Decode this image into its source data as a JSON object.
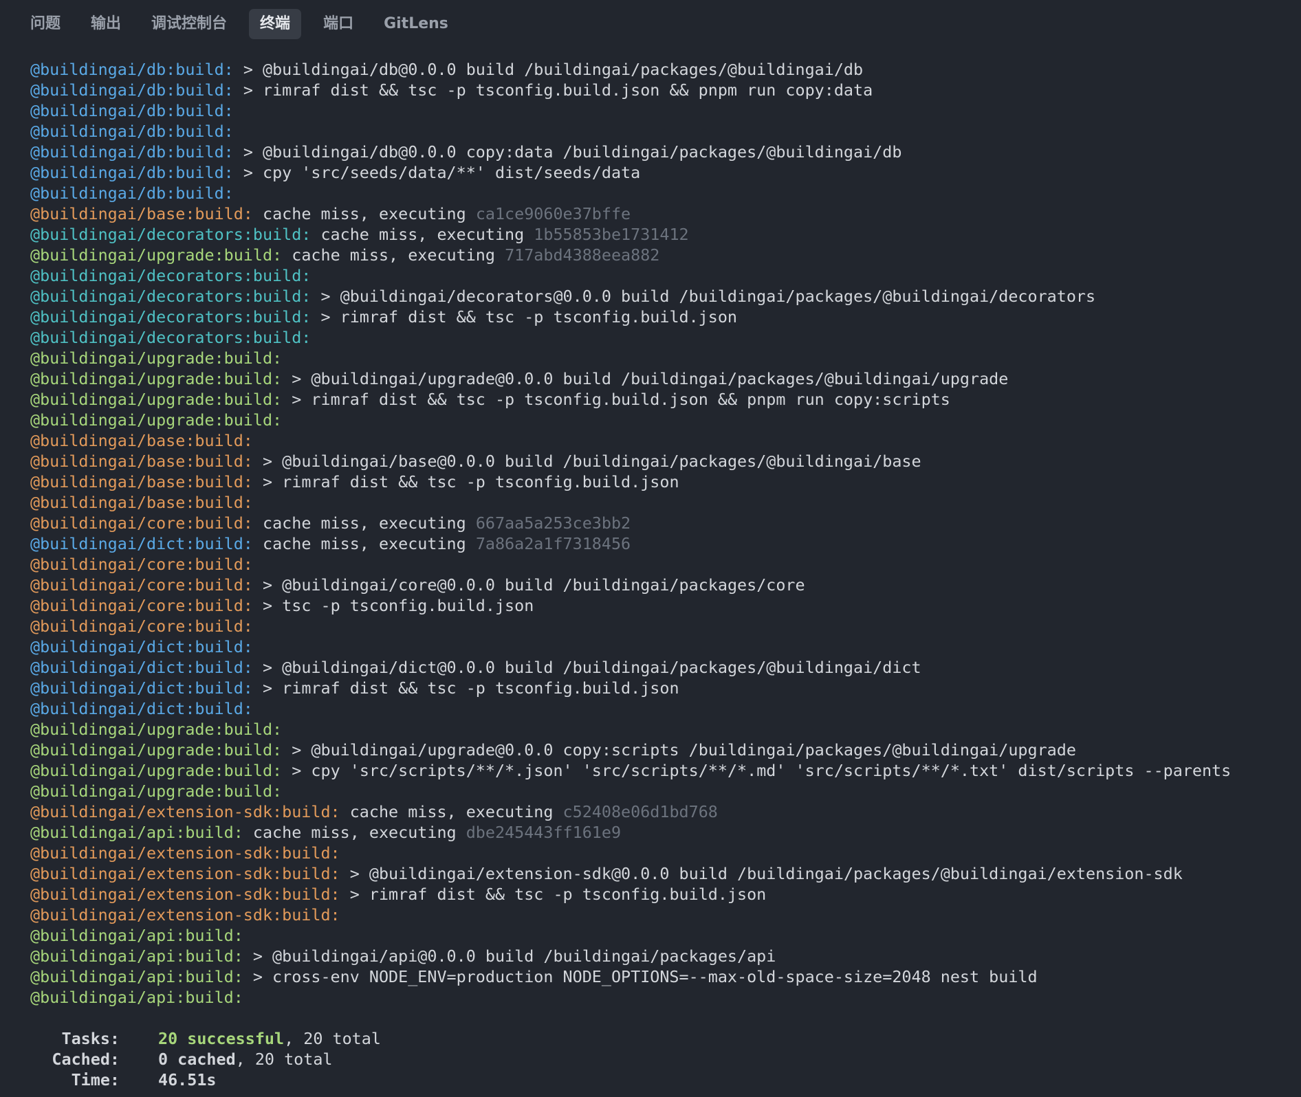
{
  "tabs": [
    {
      "label": "问题",
      "active": false
    },
    {
      "label": "输出",
      "active": false
    },
    {
      "label": "调试控制台",
      "active": false
    },
    {
      "label": "终端",
      "active": true
    },
    {
      "label": "端口",
      "active": false
    },
    {
      "label": "GitLens",
      "active": false
    }
  ],
  "colors": {
    "blue": "#5aa9e6",
    "orange": "#e29a5a",
    "green": "#a7d67b",
    "cyan": "#4fc1c4",
    "hash": "#6c737e",
    "text": "#d3d6db",
    "background": "#22262e"
  },
  "lines": [
    {
      "prefix": "@buildingai/db:build:",
      "color": "blue",
      "text": " > @buildingai/db@0.0.0 build /buildingai/packages/@buildingai/db"
    },
    {
      "prefix": "@buildingai/db:build:",
      "color": "blue",
      "text": " > rimraf dist && tsc -p tsconfig.build.json && pnpm run copy:data"
    },
    {
      "prefix": "@buildingai/db:build:",
      "color": "blue",
      "text": ""
    },
    {
      "prefix": "@buildingai/db:build:",
      "color": "blue",
      "text": ""
    },
    {
      "prefix": "@buildingai/db:build:",
      "color": "blue",
      "text": " > @buildingai/db@0.0.0 copy:data /buildingai/packages/@buildingai/db"
    },
    {
      "prefix": "@buildingai/db:build:",
      "color": "blue",
      "text": " > cpy 'src/seeds/data/**' dist/seeds/data"
    },
    {
      "prefix": "@buildingai/db:build:",
      "color": "blue",
      "text": ""
    },
    {
      "prefix": "@buildingai/base:build:",
      "color": "orange",
      "text": " cache miss, executing ",
      "hash": "ca1ce9060e37bffe"
    },
    {
      "prefix": "@buildingai/decorators:build:",
      "color": "cyan",
      "text": " cache miss, executing ",
      "hash": "1b55853be1731412"
    },
    {
      "prefix": "@buildingai/upgrade:build:",
      "color": "green",
      "text": " cache miss, executing ",
      "hash": "717abd4388eea882"
    },
    {
      "prefix": "@buildingai/decorators:build:",
      "color": "cyan",
      "text": ""
    },
    {
      "prefix": "@buildingai/decorators:build:",
      "color": "cyan",
      "text": " > @buildingai/decorators@0.0.0 build /buildingai/packages/@buildingai/decorators"
    },
    {
      "prefix": "@buildingai/decorators:build:",
      "color": "cyan",
      "text": " > rimraf dist && tsc -p tsconfig.build.json"
    },
    {
      "prefix": "@buildingai/decorators:build:",
      "color": "cyan",
      "text": ""
    },
    {
      "prefix": "@buildingai/upgrade:build:",
      "color": "green",
      "text": ""
    },
    {
      "prefix": "@buildingai/upgrade:build:",
      "color": "green",
      "text": " > @buildingai/upgrade@0.0.0 build /buildingai/packages/@buildingai/upgrade"
    },
    {
      "prefix": "@buildingai/upgrade:build:",
      "color": "green",
      "text": " > rimraf dist && tsc -p tsconfig.build.json && pnpm run copy:scripts"
    },
    {
      "prefix": "@buildingai/upgrade:build:",
      "color": "green",
      "text": ""
    },
    {
      "prefix": "@buildingai/base:build:",
      "color": "orange",
      "text": ""
    },
    {
      "prefix": "@buildingai/base:build:",
      "color": "orange",
      "text": " > @buildingai/base@0.0.0 build /buildingai/packages/@buildingai/base"
    },
    {
      "prefix": "@buildingai/base:build:",
      "color": "orange",
      "text": " > rimraf dist && tsc -p tsconfig.build.json"
    },
    {
      "prefix": "@buildingai/base:build:",
      "color": "orange",
      "text": ""
    },
    {
      "prefix": "@buildingai/core:build:",
      "color": "orange",
      "text": " cache miss, executing ",
      "hash": "667aa5a253ce3bb2"
    },
    {
      "prefix": "@buildingai/dict:build:",
      "color": "blue",
      "text": " cache miss, executing ",
      "hash": "7a86a2a1f7318456"
    },
    {
      "prefix": "@buildingai/core:build:",
      "color": "orange",
      "text": ""
    },
    {
      "prefix": "@buildingai/core:build:",
      "color": "orange",
      "text": " > @buildingai/core@0.0.0 build /buildingai/packages/core"
    },
    {
      "prefix": "@buildingai/core:build:",
      "color": "orange",
      "text": " > tsc -p tsconfig.build.json"
    },
    {
      "prefix": "@buildingai/core:build:",
      "color": "orange",
      "text": ""
    },
    {
      "prefix": "@buildingai/dict:build:",
      "color": "blue",
      "text": ""
    },
    {
      "prefix": "@buildingai/dict:build:",
      "color": "blue",
      "text": " > @buildingai/dict@0.0.0 build /buildingai/packages/@buildingai/dict"
    },
    {
      "prefix": "@buildingai/dict:build:",
      "color": "blue",
      "text": " > rimraf dist && tsc -p tsconfig.build.json"
    },
    {
      "prefix": "@buildingai/dict:build:",
      "color": "blue",
      "text": ""
    },
    {
      "prefix": "@buildingai/upgrade:build:",
      "color": "green",
      "text": ""
    },
    {
      "prefix": "@buildingai/upgrade:build:",
      "color": "green",
      "text": " > @buildingai/upgrade@0.0.0 copy:scripts /buildingai/packages/@buildingai/upgrade"
    },
    {
      "prefix": "@buildingai/upgrade:build:",
      "color": "green",
      "text": " > cpy 'src/scripts/**/*.json' 'src/scripts/**/*.md' 'src/scripts/**/*.txt' dist/scripts --parents"
    },
    {
      "prefix": "@buildingai/upgrade:build:",
      "color": "green",
      "text": ""
    },
    {
      "prefix": "@buildingai/extension-sdk:build:",
      "color": "orange",
      "text": " cache miss, executing ",
      "hash": "c52408e06d1bd768"
    },
    {
      "prefix": "@buildingai/api:build:",
      "color": "green",
      "text": " cache miss, executing ",
      "hash": "dbe245443ff161e9"
    },
    {
      "prefix": "@buildingai/extension-sdk:build:",
      "color": "orange",
      "text": ""
    },
    {
      "prefix": "@buildingai/extension-sdk:build:",
      "color": "orange",
      "text": " > @buildingai/extension-sdk@0.0.0 build /buildingai/packages/@buildingai/extension-sdk"
    },
    {
      "prefix": "@buildingai/extension-sdk:build:",
      "color": "orange",
      "text": " > rimraf dist && tsc -p tsconfig.build.json"
    },
    {
      "prefix": "@buildingai/extension-sdk:build:",
      "color": "orange",
      "text": ""
    },
    {
      "prefix": "@buildingai/api:build:",
      "color": "green",
      "text": ""
    },
    {
      "prefix": "@buildingai/api:build:",
      "color": "green",
      "text": " > @buildingai/api@0.0.0 build /buildingai/packages/api"
    },
    {
      "prefix": "@buildingai/api:build:",
      "color": "green",
      "text": " > cross-env NODE_ENV=production NODE_OPTIONS=--max-old-space-size=2048 nest build"
    },
    {
      "prefix": "@buildingai/api:build:",
      "color": "green",
      "text": ""
    }
  ],
  "summary": {
    "tasks_label": "Tasks:",
    "tasks_success": "20 successful",
    "tasks_total": ", 20 total",
    "cached_label": "Cached:",
    "cached_value": "0 cached",
    "cached_total": ", 20 total",
    "time_label": "Time:",
    "time_value": "46.51s"
  }
}
